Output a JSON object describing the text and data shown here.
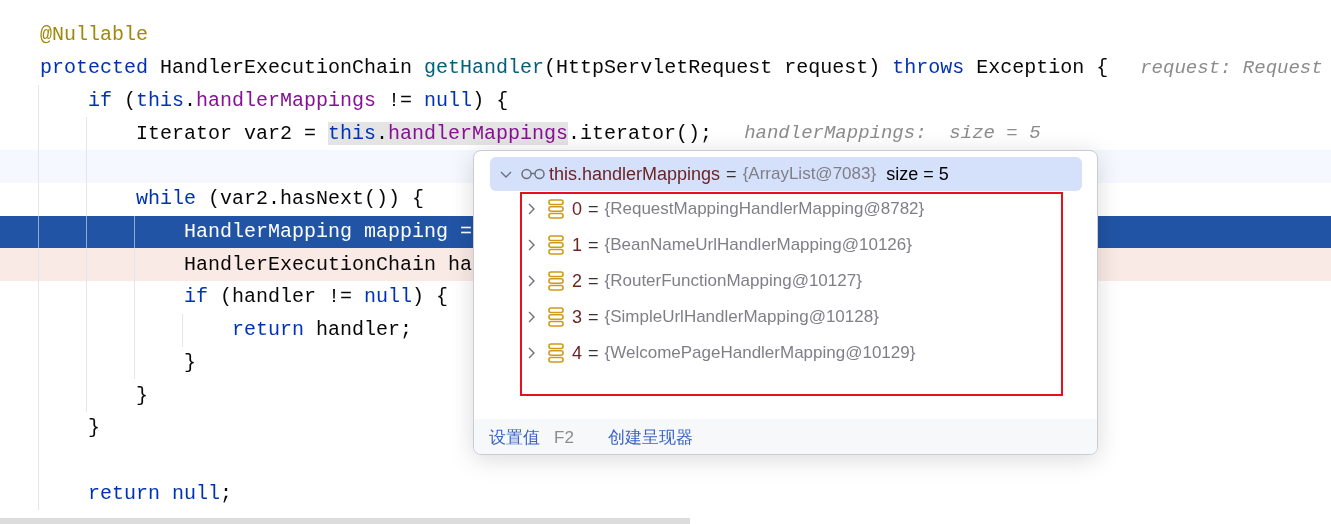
{
  "code_lines": [
    {
      "kind": "code",
      "tokens": [
        {
          "kind": "annotation",
          "text": "@Nullable"
        }
      ]
    },
    {
      "kind": "code",
      "tokens": [
        {
          "kind": "keyword",
          "text": "protected "
        },
        {
          "kind": "plain",
          "text": "HandlerExecutionChain "
        },
        {
          "kind": "method",
          "text": "getHandler"
        },
        {
          "kind": "plain",
          "text": "(HttpServletRequest request) "
        },
        {
          "kind": "keyword",
          "text": "throws "
        },
        {
          "kind": "plain",
          "text": "Exception {"
        }
      ],
      "hint": "request: Request",
      "children": [
        {
          "kind": "code",
          "tokens": [
            {
              "kind": "keyword",
              "text": "if "
            },
            {
              "kind": "plain",
              "text": "("
            },
            {
              "kind": "keyword",
              "text": "this"
            },
            {
              "kind": "plain",
              "text": "."
            },
            {
              "kind": "field",
              "text": "handlerMappings"
            },
            {
              "kind": "plain",
              "text": " != "
            },
            {
              "kind": "keyword",
              "text": "null"
            },
            {
              "kind": "plain",
              "text": ") {"
            }
          ],
          "children": [
            {
              "kind": "code",
              "tokens": [
                {
                  "kind": "plain",
                  "text": "Iterator var2 = "
                },
                {
                  "kind": "keyword",
                  "text": "this",
                  "highlighted": true
                },
                {
                  "kind": "plain",
                  "text": ".",
                  "highlighted": true
                },
                {
                  "kind": "field",
                  "text": "handlerMappings",
                  "highlighted": true
                },
                {
                  "kind": "plain",
                  "text": ".iterator();"
                }
              ],
              "hint": "handlerMappings:  size = 5"
            },
            {
              "kind": "current_blank"
            },
            {
              "kind": "code",
              "tokens": [
                {
                  "kind": "keyword",
                  "text": "while "
                },
                {
                  "kind": "plain",
                  "text": "(var2.hasNext()) {"
                }
              ],
              "children": [
                {
                  "kind": "execution",
                  "tokens": [
                    {
                      "kind": "plain",
                      "text": "HandlerMapping mapping ="
                    }
                  ]
                },
                {
                  "kind": "marked",
                  "tokens": [
                    {
                      "kind": "plain",
                      "text": "HandlerExecutionChain ha"
                    }
                  ]
                },
                {
                  "kind": "code",
                  "tokens": [
                    {
                      "kind": "keyword",
                      "text": "if "
                    },
                    {
                      "kind": "plain",
                      "text": "(handler != "
                    },
                    {
                      "kind": "keyword",
                      "text": "null"
                    },
                    {
                      "kind": "plain",
                      "text": ") {"
                    }
                  ],
                  "children": [
                    {
                      "kind": "code",
                      "tokens": [
                        {
                          "kind": "keyword",
                          "text": "return "
                        },
                        {
                          "kind": "plain",
                          "text": "handler;"
                        }
                      ]
                    }
                  ]
                },
                {
                  "kind": "code",
                  "tokens": [
                    {
                      "kind": "plain",
                      "text": "}"
                    }
                  ]
                }
              ]
            },
            {
              "kind": "code",
              "tokens": [
                {
                  "kind": "plain",
                  "text": "}"
                }
              ]
            }
          ]
        },
        {
          "kind": "code",
          "tokens": [
            {
              "kind": "plain",
              "text": "}"
            }
          ]
        },
        {
          "kind": "blank"
        },
        {
          "kind": "code",
          "tokens": [
            {
              "kind": "keyword",
              "text": "return "
            },
            {
              "kind": "keyword",
              "text": "null"
            },
            {
              "kind": "plain",
              "text": ";"
            }
          ]
        }
      ]
    }
  ],
  "debug_popup": {
    "expanded": true,
    "selected": true,
    "name": "this.handlerMappings",
    "op": "=",
    "value": "{ArrayList@7083}",
    "size": "size = 5",
    "children": [
      {
        "index": "0",
        "op": "=",
        "value": "{RequestMappingHandlerMapping@8782}",
        "expanded": false
      },
      {
        "index": "1",
        "op": "=",
        "value": "{BeanNameUrlHandlerMapping@10126}",
        "expanded": false
      },
      {
        "index": "2",
        "op": "=",
        "value": "{RouterFunctionMapping@10127}",
        "expanded": false
      },
      {
        "index": "3",
        "op": "=",
        "value": "{SimpleUrlHandlerMapping@10128}",
        "expanded": false
      },
      {
        "index": "4",
        "op": "=",
        "value": "{WelcomePageHandlerMapping@10129}",
        "expanded": false
      }
    ],
    "actions": [
      {
        "label": "设置值",
        "shortcut": "F2"
      },
      {
        "label": "创建呈现器"
      }
    ]
  }
}
